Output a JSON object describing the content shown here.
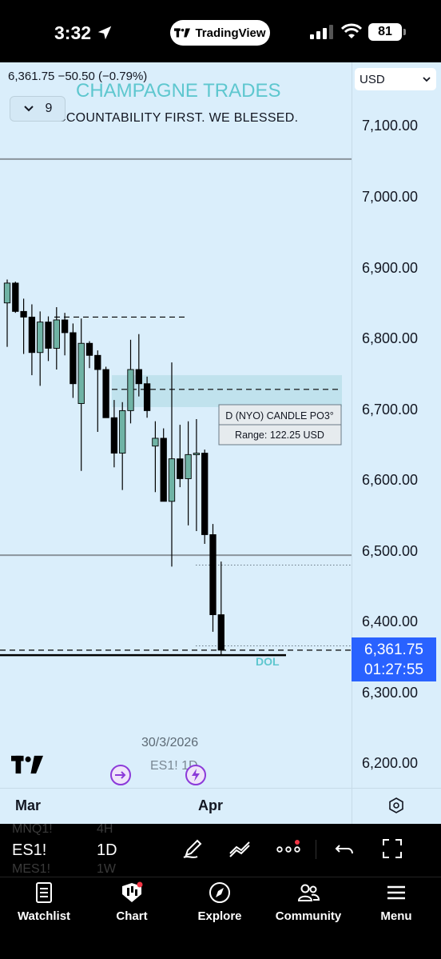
{
  "status_bar": {
    "time": "3:32",
    "app_pill": "TradingView",
    "battery": "81"
  },
  "chart": {
    "ohlc_summary": "6,361.75  −50.50 (−0.79%)",
    "watermark_title": "CHAMPAGNE TRADES",
    "watermark_subtitle": "ACCOUNTABILITY FIRST. WE BLESSED.",
    "indicator_count": "9",
    "currency": "USD",
    "price_labels": [
      "7,100.00",
      "7,000.00",
      "6,900.00",
      "6,800.00",
      "6,700.00",
      "6,600.00",
      "6,500.00",
      "6,400.00",
      "6,300.00",
      "6,200.00"
    ],
    "last_price": "6,361.75",
    "countdown": "01:27:55",
    "annotation_title": "D (NYO) CANDLE PO3°",
    "annotation_range": "Range: 122.25 USD",
    "dol_label": "DOL",
    "date_tooltip": "30/3/2026",
    "symbol_faint": "ES1! 1D",
    "month_labels": [
      "Mar",
      "Apr"
    ],
    "colors": {
      "background": "#daeefb",
      "bull": "#6fb3a5",
      "bear": "#000000",
      "watermark": "#5ec7cf",
      "last_price": "#2962ff",
      "accent_purple": "#8c3ad9"
    }
  },
  "chart_data": {
    "type": "candlestick",
    "title": "",
    "xlabel": "",
    "ylabel": "",
    "ylim": [
      6170,
      7175
    ],
    "x": [
      "Mar",
      "Apr"
    ],
    "candles": [
      {
        "o": 6852,
        "h": 6885,
        "l": 6790,
        "c": 6880
      },
      {
        "o": 6880,
        "h": 6882,
        "l": 6838,
        "c": 6840
      },
      {
        "o": 6840,
        "h": 6858,
        "l": 6780,
        "c": 6832
      },
      {
        "o": 6832,
        "h": 6850,
        "l": 6750,
        "c": 6782
      },
      {
        "o": 6782,
        "h": 6840,
        "l": 6735,
        "c": 6825
      },
      {
        "o": 6825,
        "h": 6833,
        "l": 6770,
        "c": 6788
      },
      {
        "o": 6788,
        "h": 6846,
        "l": 6758,
        "c": 6828
      },
      {
        "o": 6828,
        "h": 6838,
        "l": 6778,
        "c": 6810
      },
      {
        "o": 6810,
        "h": 6823,
        "l": 6718,
        "c": 6738
      },
      {
        "o": 6710,
        "h": 6830,
        "l": 6615,
        "c": 6795
      },
      {
        "o": 6795,
        "h": 6798,
        "l": 6760,
        "c": 6778
      },
      {
        "o": 6778,
        "h": 6785,
        "l": 6670,
        "c": 6758
      },
      {
        "o": 6758,
        "h": 6762,
        "l": 6690,
        "c": 6690
      },
      {
        "o": 6690,
        "h": 6715,
        "l": 6620,
        "c": 6640
      },
      {
        "o": 6640,
        "h": 6712,
        "l": 6588,
        "c": 6700
      },
      {
        "o": 6700,
        "h": 6800,
        "l": 6682,
        "c": 6758
      },
      {
        "o": 6758,
        "h": 6808,
        "l": 6720,
        "c": 6738
      },
      {
        "o": 6738,
        "h": 6748,
        "l": 6690,
        "c": 6700
      },
      {
        "o": 6650,
        "h": 6685,
        "l": 6585,
        "c": 6661
      },
      {
        "o": 6661,
        "h": 6675,
        "l": 6575,
        "c": 6572
      },
      {
        "o": 6572,
        "h": 6768,
        "l": 6480,
        "c": 6632
      },
      {
        "o": 6632,
        "h": 6680,
        "l": 6592,
        "c": 6604
      },
      {
        "o": 6604,
        "h": 6685,
        "l": 6538,
        "c": 6638
      },
      {
        "o": 6638,
        "h": 6688,
        "l": 6530,
        "c": 6640
      },
      {
        "o": 6640,
        "h": 6645,
        "l": 6512,
        "c": 6525
      },
      {
        "o": 6525,
        "h": 6540,
        "l": 6388,
        "c": 6412
      },
      {
        "o": 6412,
        "h": 6487,
        "l": 6356,
        "c": 6362
      }
    ],
    "horizontal_lines": [
      {
        "price": 7055,
        "style": "solid"
      },
      {
        "price": 6496,
        "style": "solid"
      },
      {
        "price": 6355,
        "style": "solid"
      },
      {
        "price": 6832,
        "style": "dashed"
      },
      {
        "price": 6730,
        "style": "dashed"
      },
      {
        "price": 6362,
        "style": "dashed"
      },
      {
        "price": 6482,
        "style": "dotted"
      },
      {
        "price": 6368,
        "style": "dotted"
      }
    ],
    "zones": [
      {
        "top": 6750,
        "bottom": 6705
      }
    ],
    "grid": false,
    "legend": "none"
  },
  "toolbar": {
    "symbol": "ES1!",
    "interval": "1D",
    "faint_symbols": [
      "MNQ1!",
      "MES1!"
    ],
    "faint_intervals": [
      "4H",
      "1W"
    ]
  },
  "bottom_nav": {
    "items": [
      "Watchlist",
      "Chart",
      "Explore",
      "Community",
      "Menu"
    ]
  },
  "icons": [
    "location-arrow-icon",
    "tradingview-logo-icon",
    "signal-icon",
    "wifi-icon",
    "chevron-down-icon",
    "settings-icon",
    "pen-icon",
    "line-tool-icon",
    "more-icon",
    "undo-icon",
    "fullscreen-icon",
    "watchlist-icon",
    "chart-icon",
    "compass-icon",
    "community-icon",
    "menu-icon"
  ]
}
